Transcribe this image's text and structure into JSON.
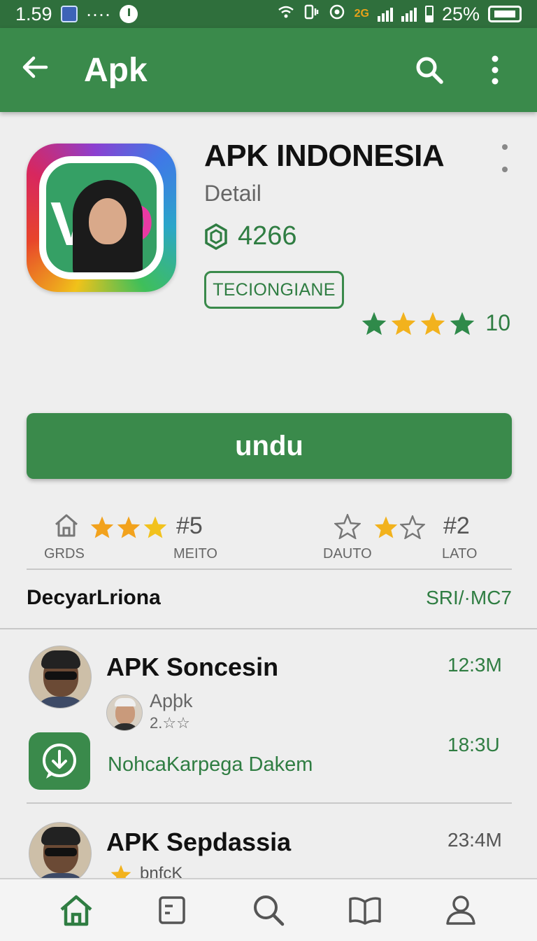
{
  "status_bar": {
    "time": "1.59",
    "dots": "····",
    "battery_percent": "25%",
    "network_badge": "2G"
  },
  "app_bar": {
    "title": "Apk"
  },
  "app": {
    "name": "APK INDONESIA",
    "subtitle": "Detail",
    "downloads": "4266",
    "tag": "TECIONGIANE",
    "rating_count": "10",
    "rating_stars": [
      "green",
      "yellow",
      "yellow",
      "green"
    ]
  },
  "download_button": {
    "label": "undu"
  },
  "stats": [
    {
      "label": "GRDS",
      "icon": "home-icon"
    },
    {
      "label": "MEITO",
      "rank": "#5",
      "stars_filled": 3,
      "stars_total": 3
    },
    {
      "label": "DAUTO",
      "icon": "star-outline-icon"
    },
    {
      "label": "LATO",
      "rank": "#2",
      "stars_filled": 1,
      "stars_total": 2
    }
  ],
  "section": {
    "title": "DecyarLriona",
    "link": "SRI/·MC7"
  },
  "list": [
    {
      "title": "APK Soncesin",
      "time": "12:3M",
      "sub_name": "Apþk",
      "sub_rating": "2.☆☆",
      "download_text": "NohcaKarpega Dakem",
      "download_time": "18:3U"
    },
    {
      "title": "APK Sepdassia",
      "time": "23:4M",
      "sub_text": "bnfcK"
    }
  ],
  "bottom_nav": [
    "home-icon",
    "document-icon",
    "search-icon",
    "book-icon",
    "profile-icon"
  ],
  "colors": {
    "primary": "#3a8a4b",
    "primary_dark": "#2f6f3c",
    "accent_text": "#2f7d42",
    "star_yellow": "#f2b21d",
    "star_green": "#2f8a4a"
  }
}
